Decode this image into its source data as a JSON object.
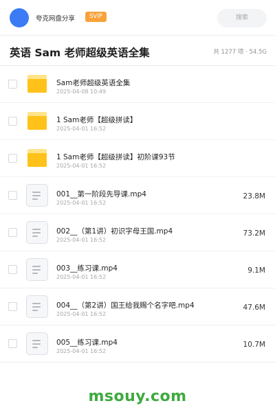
{
  "header": {
    "share_name": "夸克网盘分享",
    "badge": "SVIP",
    "search_placeholder": "搜索",
    "avatar_color": "#3b7bf6"
  },
  "title": {
    "text": "英语 Sam 老师超级英语全集",
    "summary": "共 1277 项 · 54.5G"
  },
  "items": [
    {
      "type": "folder",
      "icon": "folder-icon",
      "name": "Sam老师超级英语全集",
      "date": "2025-04-08 10:49",
      "size": ""
    },
    {
      "type": "folder",
      "icon": "folder-icon",
      "name": "1 Sam老师【超级拼读】",
      "date": "2025-04-01 16:52",
      "size": ""
    },
    {
      "type": "folder",
      "icon": "folder-icon",
      "name": "1  Sam老师【超级拼读】初阶课93节",
      "date": "2025-04-01 16:52",
      "size": ""
    },
    {
      "type": "file",
      "icon": "file-icon",
      "name": "001__第一阶段先导课.mp4",
      "date": "2025-04-01 16:52",
      "size": "23.8M"
    },
    {
      "type": "file",
      "icon": "file-icon",
      "name": "002__（第1讲）初识字母王国.mp4",
      "date": "2025-04-01 16:52",
      "size": "73.2M"
    },
    {
      "type": "file",
      "icon": "file-icon",
      "name": "003__练习课.mp4",
      "date": "2025-04-01 16:52",
      "size": "9.1M"
    },
    {
      "type": "file",
      "icon": "file-icon",
      "name": "004__（第2讲）国王给我赐个名字吧.mp4",
      "date": "2025-04-01 16:52",
      "size": "47.6M"
    },
    {
      "type": "file",
      "icon": "file-icon",
      "name": "005__练习课.mp4",
      "date": "2025-04-01 16:52",
      "size": "10.7M"
    }
  ],
  "watermark": "msouy.com",
  "colors": {
    "accent": "#3b7bf6",
    "svip": "#f7a23b",
    "folder": "#ffc21a",
    "watermark": "#3daa3d"
  }
}
